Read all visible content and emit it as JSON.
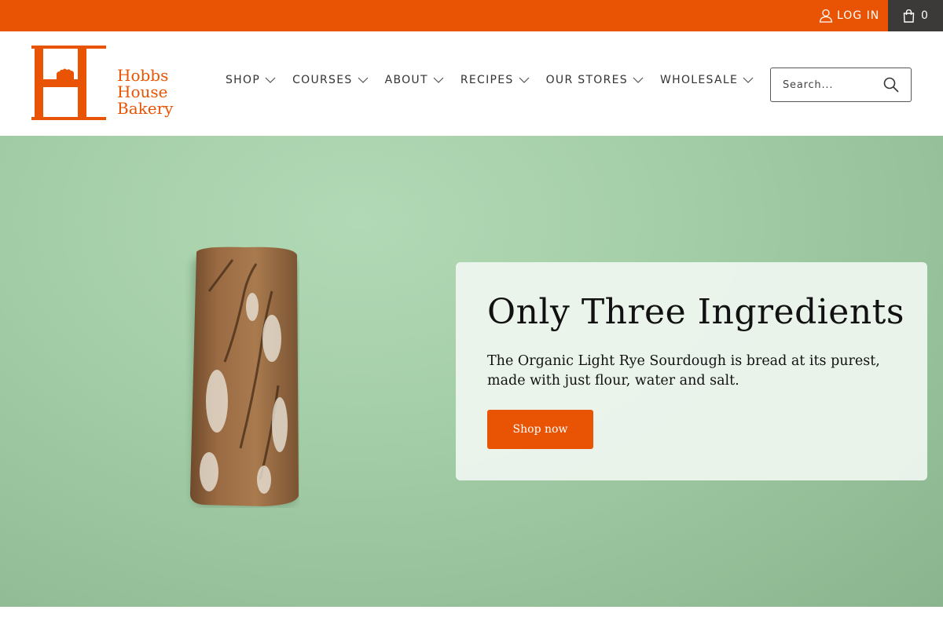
{
  "topbar": {
    "login_label": "LOG IN",
    "cart_count": "0",
    "background": "#e85404",
    "cart_background": "#3b3a39"
  },
  "header": {
    "logo": {
      "lines": [
        "Hobbs",
        "House",
        "Bakery"
      ],
      "color": "#e85404"
    },
    "nav": [
      {
        "label": "SHOP"
      },
      {
        "label": "COURSES"
      },
      {
        "label": "ABOUT"
      },
      {
        "label": "RECIPES"
      },
      {
        "label": "OUR STORES"
      },
      {
        "label": "WHOLESALE"
      }
    ],
    "search": {
      "placeholder": "Search...",
      "icon": "search-icon"
    }
  },
  "hero": {
    "title": "Only Three Ingredients",
    "text": "The Organic Light Rye Sourdough is bread at its purest, made with just flour, water and salt.",
    "button_label": "Shop now",
    "background": "#a5cfa9",
    "button_color": "#e85404"
  }
}
